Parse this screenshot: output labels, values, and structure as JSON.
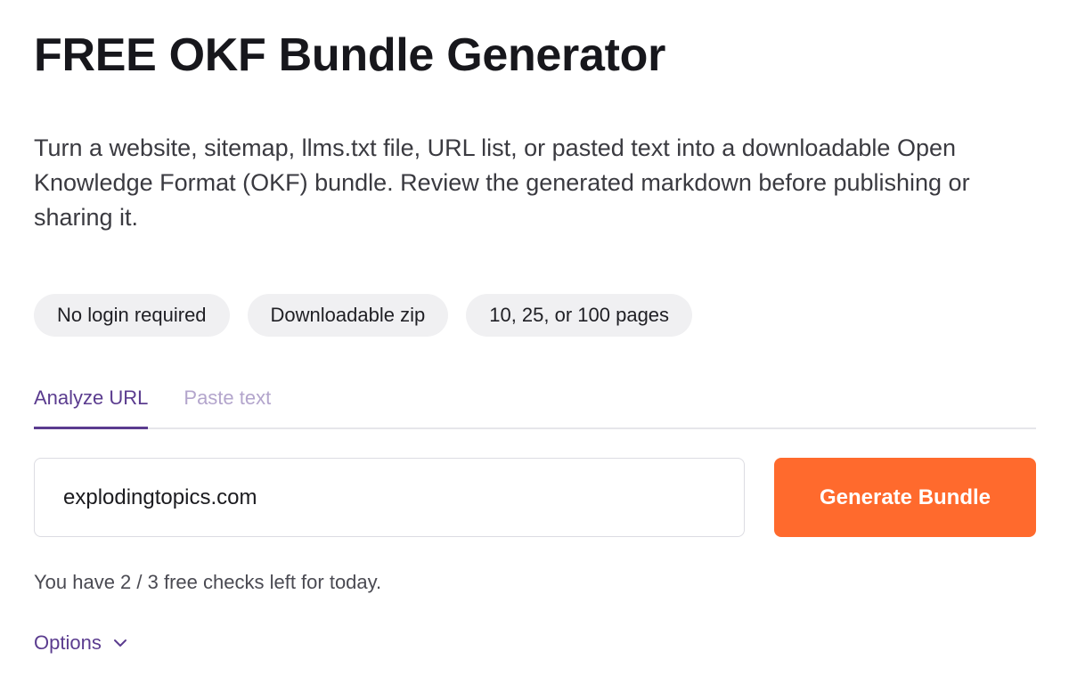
{
  "header": {
    "title": "FREE OKF Bundle Generator",
    "description": "Turn a website, sitemap, llms.txt file, URL list, or pasted text into a downloadable Open Knowledge Format (OKF) bundle. Review the generated markdown before publishing or sharing it."
  },
  "features": [
    {
      "label": "No login required"
    },
    {
      "label": "Downloadable zip"
    },
    {
      "label": "10, 25, or 100 pages"
    }
  ],
  "tabs": [
    {
      "label": "Analyze URL",
      "active": true
    },
    {
      "label": "Paste text",
      "active": false
    }
  ],
  "form": {
    "url_value": "explodingtopics.com",
    "url_placeholder": "",
    "submit_label": "Generate Bundle"
  },
  "status": {
    "checks_left": "You have 2 / 3 free checks left for today."
  },
  "options": {
    "label": "Options",
    "icon": "chevron-down-icon"
  },
  "colors": {
    "accent": "#5b3c8f",
    "accent_muted": "#b3a5cc",
    "button": "#ff6a2d",
    "pill_bg": "#f0f0f2"
  }
}
